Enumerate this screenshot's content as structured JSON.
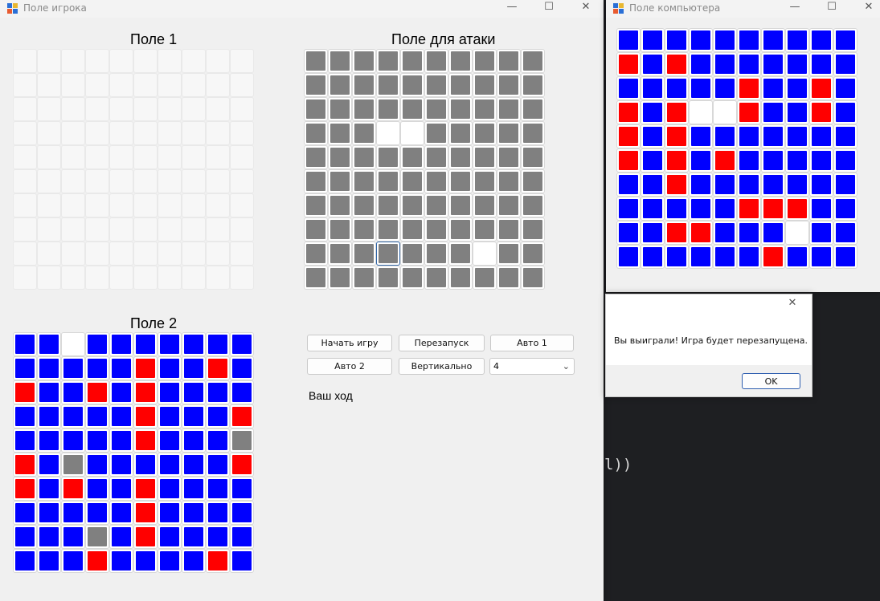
{
  "colors": {
    "blue": "#0000ff",
    "red": "#ff0000",
    "gray": "#808080",
    "white": "#ffffff",
    "empty": "#f7f7f7"
  },
  "player_window": {
    "title": "Поле игрока",
    "icon": "app-grid-icon",
    "field1_label": "Поле 1",
    "attack_label": "Поле для атаки",
    "field2_label": "Поле 2",
    "buttons": {
      "start": "Начать игру",
      "restart": "Перезапуск",
      "auto1": "Авто 1",
      "auto2": "Авто 2",
      "vertical": "Вертикально"
    },
    "size_select": "4",
    "status": "Ваш ход",
    "attack_grid": [
      "GGGGGGGGGG",
      "GGGGGGGGGG",
      "GGGGGGGGGG",
      "GGGWWGGGGG",
      "GGGGGGGGGG",
      "GGGGGGGGGG",
      "GGGGGGGGGG",
      "GGGGGGGGGG",
      "GGGSGGGWGG",
      "GGGGGGGGGG"
    ],
    "field2_grid": [
      "BBWBBBBBBB",
      "BBBBBRBBRB",
      "RBBRBRBBBB",
      "BBBBBRBBBR",
      "BBBBBRBBBG",
      "RBGBBBBBBR",
      "RBRBBRBBBB",
      "BBBBBRBBBB",
      "BBBGBRBBBB",
      "BBBRBBBBRB"
    ]
  },
  "computer_window": {
    "title": "Поле компьютера",
    "grid": [
      "BBBBBBBBBB",
      "RBRBBBBBBB",
      "BBBBBRBBRB",
      "RBRWWRBBRB",
      "RBRBBBBBBB",
      "RBRBRBBBBB",
      "BBRBBBBBBB",
      "BBBBBRRRBB",
      "BBRRBBBWBB",
      "BBBBBBRBBB"
    ]
  },
  "dialog": {
    "message": "Вы выиграли! Игра будет перезапущена.",
    "ok": "OK"
  },
  "background_code": {
    "text": "l))",
    "fragment": ","
  }
}
